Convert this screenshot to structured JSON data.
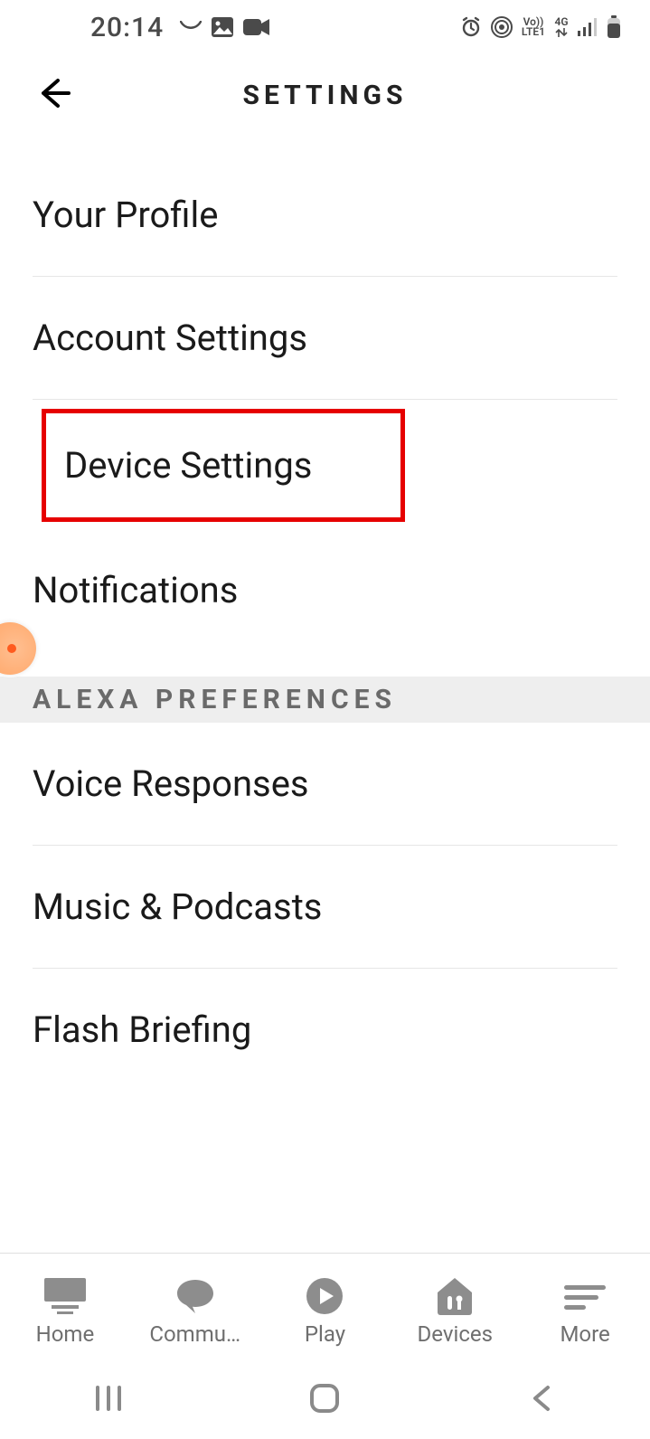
{
  "status": {
    "time": "20:14",
    "network_small": "Vo))",
    "network_lte": "LTE1",
    "network_gen": "4G"
  },
  "header": {
    "title": "SETTINGS"
  },
  "settings": {
    "items": [
      {
        "label": "Your Profile"
      },
      {
        "label": "Account Settings"
      },
      {
        "label": "Device Settings"
      },
      {
        "label": "Notifications"
      }
    ]
  },
  "section_header": "ALEXA PREFERENCES",
  "preferences": {
    "items": [
      {
        "label": "Voice Responses"
      },
      {
        "label": "Music & Podcasts"
      },
      {
        "label": "Flash Briefing"
      }
    ]
  },
  "tabs": {
    "items": [
      {
        "label": "Home"
      },
      {
        "label": "Commu…"
      },
      {
        "label": "Play"
      },
      {
        "label": "Devices"
      },
      {
        "label": "More"
      }
    ]
  }
}
